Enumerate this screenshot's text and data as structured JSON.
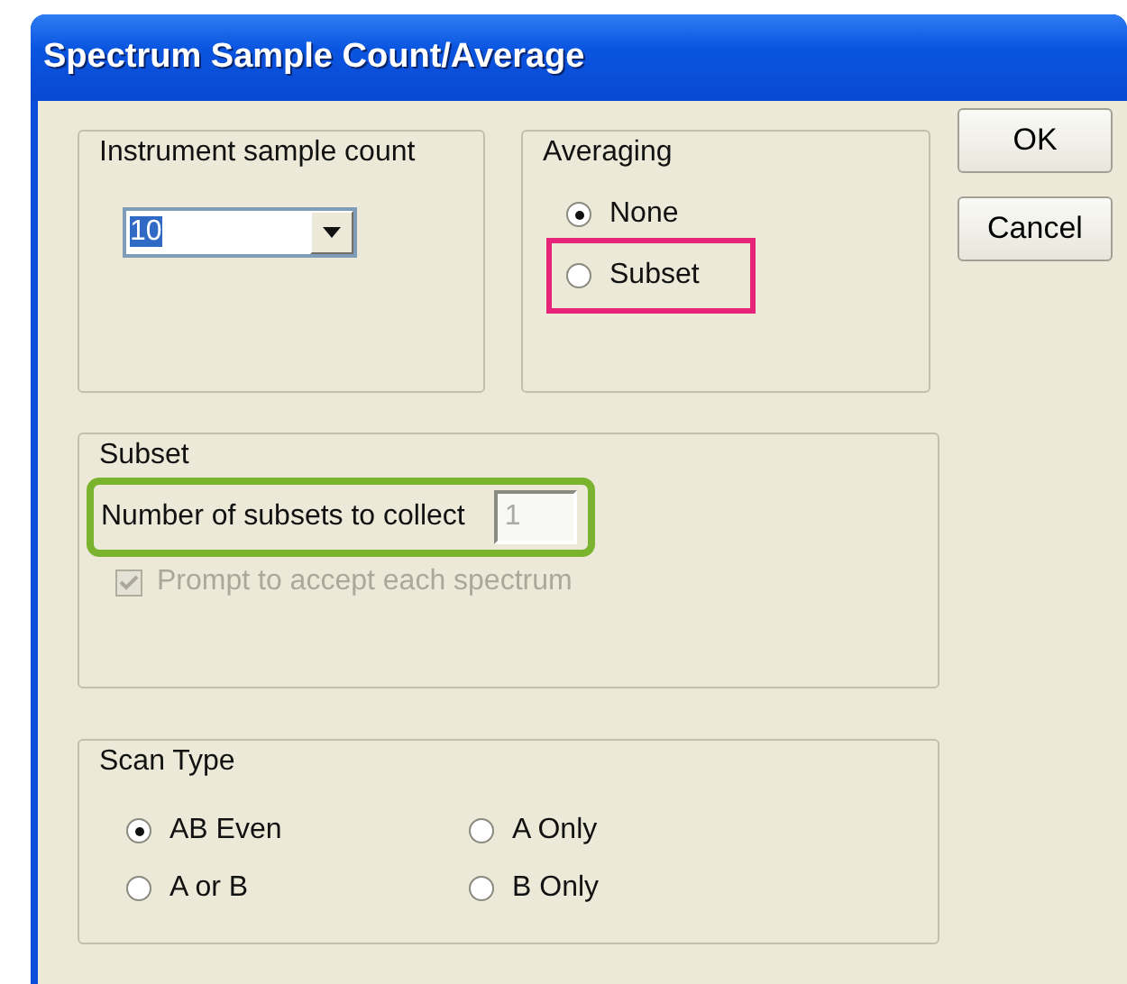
{
  "window": {
    "title": "Spectrum Sample Count/Average"
  },
  "instrument_sample_count": {
    "label": "Instrument sample count",
    "value": "10",
    "value_selected": true
  },
  "averaging": {
    "label": "Averaging",
    "options": [
      {
        "label": "None",
        "selected": true
      },
      {
        "label": "Subset",
        "selected": false,
        "highlight": {
          "color": "#e8247a"
        }
      }
    ]
  },
  "buttons": [
    {
      "label": "OK"
    },
    {
      "label": "Cancel"
    }
  ],
  "subset": {
    "label": "Subset",
    "count_label": "Number of subsets to collect",
    "count_value": "1",
    "count_disabled": true,
    "count_highlight": {
      "color": "#7ab32e"
    },
    "prompt": {
      "label": "Prompt to accept each spectrum",
      "checked": true,
      "disabled": true
    }
  },
  "scan_type": {
    "label": "Scan Type",
    "options": [
      {
        "label": "AB Even",
        "selected": true
      },
      {
        "label": "A Only",
        "selected": false
      },
      {
        "label": "A or B",
        "selected": false
      },
      {
        "label": "B Only",
        "selected": false
      }
    ]
  }
}
